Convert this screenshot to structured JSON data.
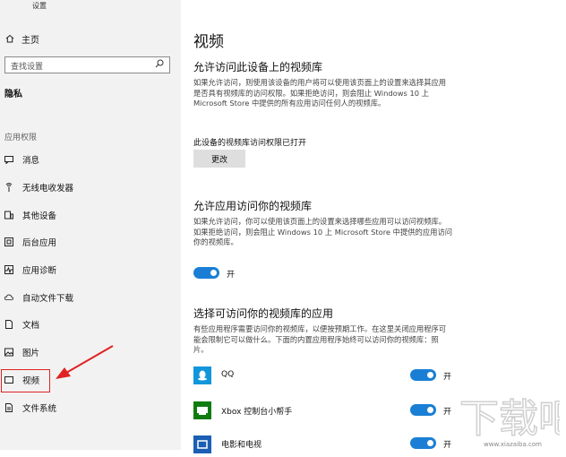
{
  "window": {
    "title": "设置"
  },
  "sidebar": {
    "home_label": "主页",
    "search_placeholder": "查找设置",
    "category": "隐私",
    "section_label": "应用权限",
    "items": [
      {
        "label": "消息",
        "icon": "message-icon"
      },
      {
        "label": "无线电收发器",
        "icon": "radio-icon"
      },
      {
        "label": "其他设备",
        "icon": "devices-icon"
      },
      {
        "label": "后台应用",
        "icon": "background-apps-icon"
      },
      {
        "label": "应用诊断",
        "icon": "diagnostics-icon"
      },
      {
        "label": "自动文件下载",
        "icon": "cloud-download-icon"
      },
      {
        "label": "文档",
        "icon": "document-icon"
      },
      {
        "label": "图片",
        "icon": "picture-icon"
      },
      {
        "label": "视频",
        "icon": "video-icon",
        "selected": true
      },
      {
        "label": "文件系统",
        "icon": "file-system-icon"
      }
    ]
  },
  "main": {
    "title": "视频",
    "device_section": {
      "heading": "允许访问此设备上的视频库",
      "description": "如果允许访问，则使用该设备的用户将可以使用该页面上的设置来选择其应用是否具有视频库的访问权限。如果拒绝访问，则会阻止 Windows 10 上 Microsoft Store 中提供的所有应用访问任何人的视频库。",
      "status": "此设备的视频库访问权限已打开",
      "change_button": "更改"
    },
    "app_section": {
      "heading": "允许应用访问你的视频库",
      "description": "如果允许访问，你可以使用该页面上的设置来选择哪些应用可以访问视频库。如果拒绝访问，则会阻止 Windows 10 上 Microsoft Store 中提供的应用访问你的视频库。",
      "toggle_label": "开",
      "toggle_on": true
    },
    "choose_section": {
      "heading": "选择可访问你的视频库的应用",
      "description": "有些应用程序需要访问你的视频库，以便按预期工作。在这里关闭应用程序可能会限制它可以做什么。下面的内置应用程序始终可以访问你的视频库：照片。",
      "apps": [
        {
          "name": "QQ",
          "toggle_label": "开",
          "on": true,
          "icon": "qq-icon",
          "color": "#1296db"
        },
        {
          "name": "Xbox 控制台小帮手",
          "toggle_label": "开",
          "on": true,
          "icon": "xbox-icon",
          "color": "#107c10"
        },
        {
          "name": "电影和电视",
          "toggle_label": "开",
          "on": true,
          "icon": "movies-tv-icon",
          "color": "#1a5fb4"
        }
      ]
    }
  },
  "colors": {
    "accent": "#1a7fd4",
    "highlight_box": "#e02222",
    "sidebar_bg": "#f2f2f2"
  },
  "watermark": {
    "text": "下载吧",
    "url": "www.xiazaiba.com"
  }
}
